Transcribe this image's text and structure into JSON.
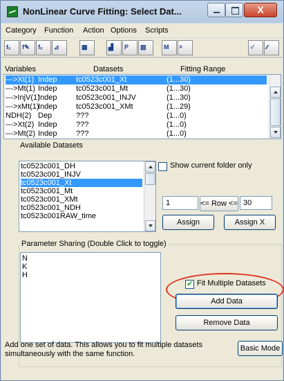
{
  "window": {
    "title": "NonLinear Curve Fitting:  Select Dat...",
    "close_glyph": "X"
  },
  "menu": [
    "Category",
    "Function",
    "Action",
    "Options",
    "Scripts"
  ],
  "toolbar": {
    "icons": [
      "fx-select-icon",
      "fx-edit-icon",
      "fx-new-icon",
      "peak-icon",
      "worksheet-icon",
      "data-mode-icon",
      "param-mode-icon",
      "graph-icon",
      "simulate-icon",
      "report-icon",
      "fit-iterate-icon",
      "fit-done-icon"
    ],
    "glyphs": [
      "fₓ",
      "f✎",
      "fₓ",
      "⊿",
      "▦",
      "▟",
      "P",
      "▧",
      "M",
      "ᵖ",
      "·∕",
      "∕∕"
    ]
  },
  "variables": {
    "headers": {
      "variables": "Variables",
      "datasets": "Datasets",
      "range": "Fitting Range"
    },
    "rows": [
      {
        "var": "--->Xt(1)",
        "type": "Indep",
        "dataset": "tc0523c001_Xt",
        "range": "(1...30)",
        "selected": true
      },
      {
        "var": "--->Mt(1)",
        "type": "Indep",
        "dataset": "tc0523c001_Mt",
        "range": "(1...30)",
        "selected": false
      },
      {
        "var": "--->InjV(1)",
        "type": "Indep",
        "dataset": "tc0523c001_INJV",
        "range": "(1...30)",
        "selected": false
      },
      {
        "var": "--->xMt(1)",
        "type": "Indep",
        "dataset": "tc0523c001_XMt",
        "range": "(1...29)",
        "selected": false
      },
      {
        "var": "NDH(2)",
        "type": "Dep",
        "dataset": "???",
        "range": "(1...0)",
        "selected": false
      },
      {
        "var": "--->Xt(2)",
        "type": "Indep",
        "dataset": "???",
        "range": "(1...0)",
        "selected": false
      },
      {
        "var": "--->Mt(2)",
        "type": "Indep",
        "dataset": "???",
        "range": "(1...0)",
        "selected": false
      }
    ]
  },
  "available": {
    "label": "Available Datasets",
    "items": [
      {
        "name": "tc0523c001_DH",
        "selected": false
      },
      {
        "name": "tc0523c001_INJV",
        "selected": false
      },
      {
        "name": "tc0523c001_Xt",
        "selected": true
      },
      {
        "name": "tc0523c001_Mt",
        "selected": false
      },
      {
        "name": "tc0523c001_XMt",
        "selected": false
      },
      {
        "name": "tc0523c001_NDH",
        "selected": false
      },
      {
        "name": "tc0523c001RAW_time",
        "selected": false
      }
    ],
    "show_current_folder_label": "Show current folder only",
    "row_from": "1",
    "row_label": "<= Row <=",
    "row_to": "30",
    "assign_label": "Assign",
    "assign_x_label": "Assign X"
  },
  "params": {
    "label": "Parameter Sharing (Double Click to toggle)",
    "items": [
      "N",
      "K",
      "H"
    ]
  },
  "multi": {
    "fit_multiple_label": "Fit Multiple Datasets",
    "fit_multiple_checked": true,
    "add_data_label": "Add Data",
    "remove_data_label": "Remove Data"
  },
  "footer": {
    "help_text": "Add one set of data. This allows you to fit multiple datasets simultaneously with the same function.",
    "basic_mode_label": "Basic Mode"
  },
  "colors": {
    "selection": "#3399ff",
    "highlight_ellipse": "#e0311f"
  }
}
